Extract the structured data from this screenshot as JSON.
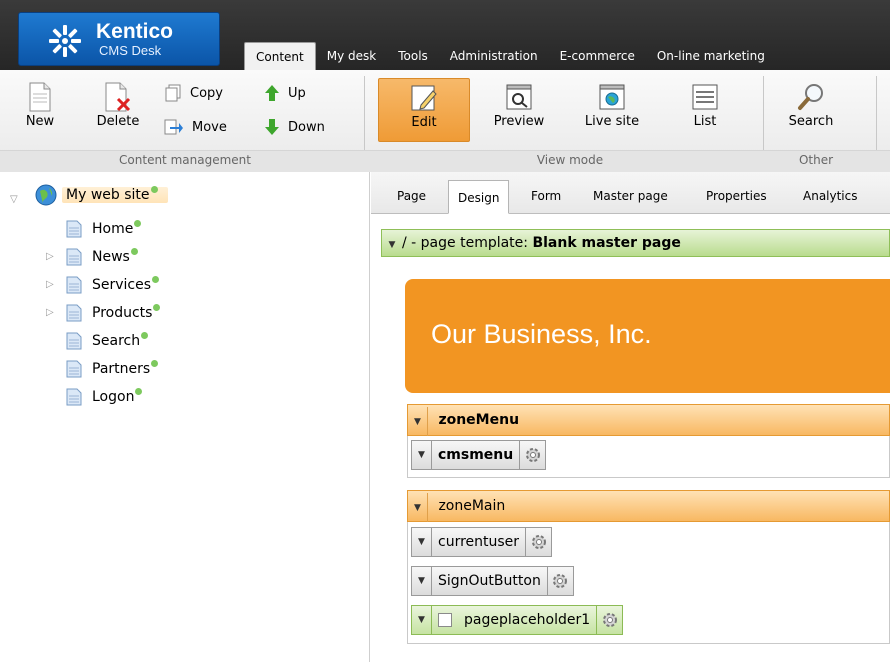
{
  "header": {
    "brand": "Kentico",
    "product": "CMS Desk",
    "tabs": [
      "Content",
      "My desk",
      "Tools",
      "Administration",
      "E-commerce",
      "On-line marketing"
    ],
    "active_tab": "Content"
  },
  "ribbon": {
    "content_management": {
      "label": "Content management",
      "new": "New",
      "delete": "Delete",
      "copy": "Copy",
      "move": "Move",
      "up": "Up",
      "down": "Down"
    },
    "view_mode": {
      "label": "View mode",
      "edit": "Edit",
      "preview": "Preview",
      "live_site": "Live site",
      "list": "List"
    },
    "other": {
      "label": "Other",
      "search": "Search"
    }
  },
  "tree": {
    "root": "My web site",
    "items": [
      "Home",
      "News",
      "Services",
      "Products",
      "Search",
      "Partners",
      "Logon"
    ]
  },
  "subtabs": [
    "Page",
    "Design",
    "Form",
    "Master page",
    "Properties",
    "Analytics"
  ],
  "active_subtab": "Design",
  "design": {
    "template_prefix": "/ - page template: ",
    "template_name": "Blank master page",
    "banner_text": "Our Business, Inc.",
    "zone_menu": "zoneMenu",
    "webpart_menu": "cmsmenu",
    "zone_main": "zoneMain",
    "webparts_main": [
      "currentuser",
      "SignOutButton",
      "pageplaceholder1"
    ]
  },
  "colors": {
    "accent_orange": "#f29522",
    "status_green": "#7dc95e",
    "brand_blue": "#0b55a8"
  }
}
